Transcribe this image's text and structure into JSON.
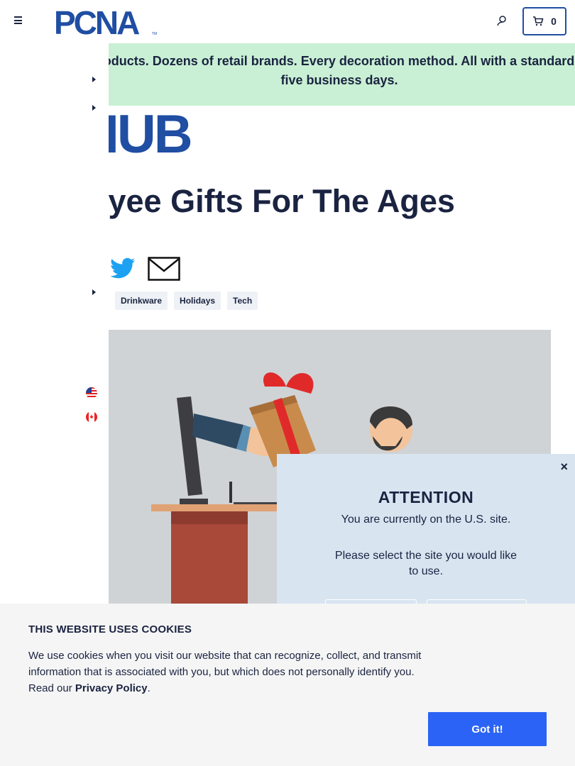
{
  "header": {
    "logo_text": "PCNA",
    "logo_tm": "TM",
    "cart_count": "0"
  },
  "banner": {
    "text": "Thousands of products. Dozens of retail brands. Every decoration method. All with a standard lead time of just five business days."
  },
  "hub": {
    "label": "HUB"
  },
  "article": {
    "title": "Employee Gifts For The Ages",
    "tags": [
      "Drinkware",
      "Holidays",
      "Tech"
    ]
  },
  "modal": {
    "close": "×",
    "title": "ATTENTION",
    "line1": "You are currently on the U.S. site.",
    "line2": "Please select the site you would like to use."
  },
  "cookie": {
    "title": "THIS WEBSITE USES COOKIES",
    "body": "We use cookies when you visit our website that can recognize, collect, and transmit information that is associated with you, but which does not personally identify you. Read our ",
    "link": "Privacy Policy",
    "period": ".",
    "button": "Got it!"
  },
  "colors": {
    "brand_blue": "#1f4ea3",
    "navy": "#1a2340",
    "banner_green": "#c9f0d4",
    "modal_bg": "#d9e4f1",
    "cookie_button": "#2a63f5"
  },
  "icons": [
    "menu-icon",
    "user-icon",
    "cart-icon",
    "twitter-icon",
    "mail-icon",
    "us-flag-icon",
    "canada-flag-icon",
    "close-icon"
  ]
}
